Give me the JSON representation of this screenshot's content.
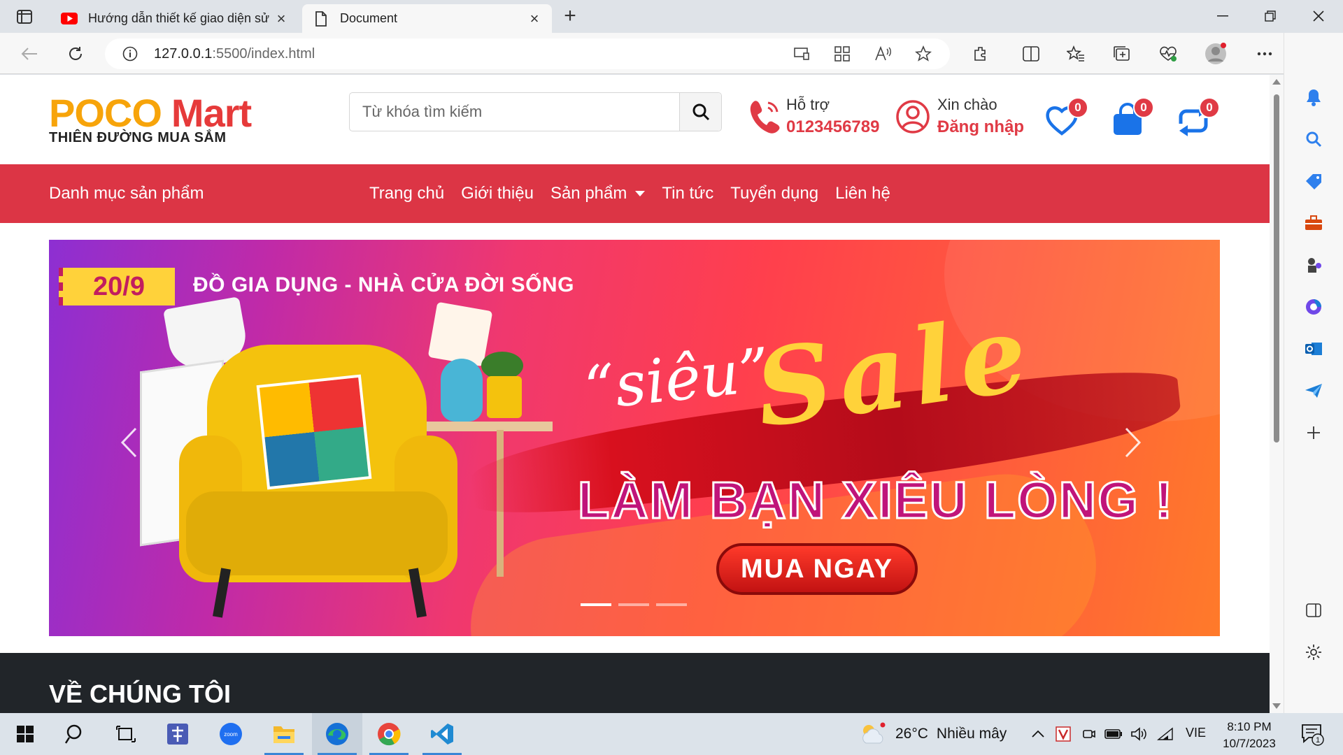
{
  "browser": {
    "tabs": [
      {
        "title": "Hướng dẫn thiết kế giao diện sử",
        "active": false,
        "favicon": "youtube-icon"
      },
      {
        "title": "Document",
        "active": true,
        "favicon": "document-icon"
      }
    ],
    "new_tab": "+",
    "address": {
      "host": "127.0.0.1",
      "path": ":5500/index.html"
    }
  },
  "header": {
    "logo": {
      "word1": "POCO",
      "word2": "Mart",
      "tagline": "THIÊN ĐƯỜNG MUA SẮM"
    },
    "search": {
      "placeholder": "Từ khóa tìm kiếm"
    },
    "support": {
      "label": "Hỗ trợ",
      "phone": "0123456789"
    },
    "account": {
      "greeting": "Xin chào",
      "login": "Đăng nhập"
    },
    "badges": {
      "wishlist": "0",
      "cart": "0",
      "compare": "0"
    }
  },
  "nav": {
    "category": "Danh mục sản phẩm",
    "links": [
      "Trang chủ",
      "Giới thiệu",
      "Sản phẩm",
      "Tin tức",
      "Tuyển dụng",
      "Liên hệ"
    ]
  },
  "banner": {
    "date": "20/9",
    "headline": "ĐỒ GIA DỤNG - NHÀ CỬA ĐỜI SỐNG",
    "sieu": "“siêu”",
    "sale": "Sale",
    "slogan": "LÀM BẠN XIÊU LÒNG !",
    "cta": "MUA NGAY",
    "slides": 3,
    "active_slide": 1
  },
  "about": {
    "title": "VỀ CHÚNG TÔI"
  },
  "taskbar": {
    "weather": {
      "temp": "26°C",
      "desc": "Nhiều mây"
    },
    "lang": "VIE",
    "time": "8:10 PM",
    "date": "10/7/2023",
    "notifications": "1"
  },
  "colors": {
    "brand_red": "#dc3545",
    "logo_orange": "#f7a40a",
    "logo_red": "#e63a3a",
    "footer_dark": "#212529"
  }
}
